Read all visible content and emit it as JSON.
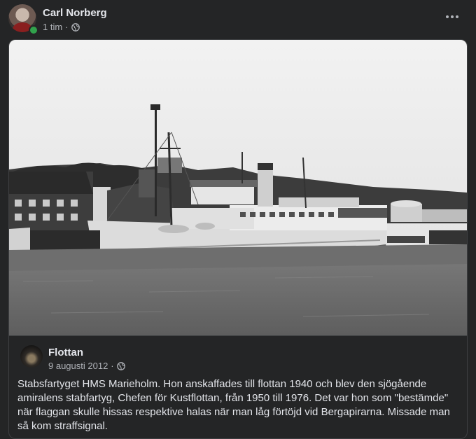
{
  "post": {
    "author": "Carl Norberg",
    "time": "1 tim",
    "separator": "·",
    "audience_icon": "globe-icon"
  },
  "shared": {
    "page_name": "Flottan",
    "date": "9 augusti 2012",
    "separator": "·",
    "audience_icon": "globe-icon",
    "text": "Stabsfartyget HMS Marieholm. Hon anskaffades till flottan 1940 och blev den sjögående amiralens stabfartyg, Chefen för Kustflottan, från 1950 till 1976. Det var hon som \"bestämde\" när flaggan skulle hissas respektive halas när man låg förtöjd vid Bergapirarna. Missade man så kom straffsignal."
  },
  "colors": {
    "background": "#242526",
    "primary_text": "#e4e6eb",
    "secondary_text": "#b0b3b8",
    "online": "#31a24c",
    "border": "#3e4042"
  }
}
